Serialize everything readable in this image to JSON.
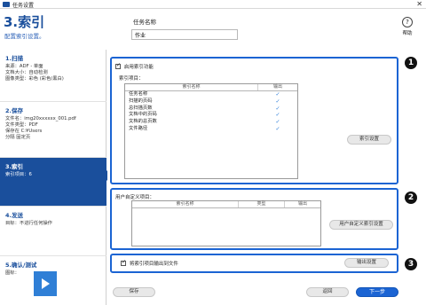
{
  "window": {
    "title": "任务设置",
    "close_glyph": "✕"
  },
  "header": {
    "step_title": "3.索引",
    "step_subtitle": "配置索引设置。",
    "task_name_label": "任务名称",
    "task_name_value": "作业",
    "help_label": "帮助",
    "help_glyph": "?"
  },
  "sidebar": {
    "items": [
      {
        "title": "1.扫描",
        "lines": [
          "来源：ADF - 单面",
          "文档大小：自动检测",
          "图像类型：彩色 (彩色/黑白)"
        ]
      },
      {
        "title": "2.保存",
        "lines": [
          "文件名：img20xxxxxx_001.pdf",
          "文件类型：PDF",
          "保存在 C:¥Users",
          "分隔 固定页"
        ]
      },
      {
        "title": "3.索引",
        "lines": [
          "索引项目：6"
        ]
      },
      {
        "title": "4.发送",
        "lines": [
          "目标：不进行任何操作"
        ]
      },
      {
        "title": "5.确认/测试",
        "lines": [
          "图标："
        ]
      }
    ]
  },
  "section1": {
    "enable_label": "启用索引功能",
    "items_label": "索引项目：",
    "col_name": "索引名称",
    "col_output": "输出",
    "rows": [
      {
        "name": "任务名称",
        "output": "✓"
      },
      {
        "name": "扫描的页码",
        "output": "✓"
      },
      {
        "name": "总扫描页数",
        "output": "✓"
      },
      {
        "name": "文档中的页码",
        "output": "✓"
      },
      {
        "name": "文档的总页数",
        "output": "✓"
      },
      {
        "name": "文件路径",
        "output": "✓"
      }
    ],
    "button": "索引设置",
    "badge": "1"
  },
  "section2": {
    "items_label": "用户自定义项目：",
    "col_name": "索引名称",
    "col_type": "类型",
    "col_output": "输出",
    "button": "用户自定义索引设置",
    "badge": "2"
  },
  "section3": {
    "output_label": "将索引项目输出到文件",
    "button": "输出设置",
    "badge": "3"
  },
  "footer": {
    "save": "保存",
    "back": "返回",
    "next": "下一步"
  }
}
